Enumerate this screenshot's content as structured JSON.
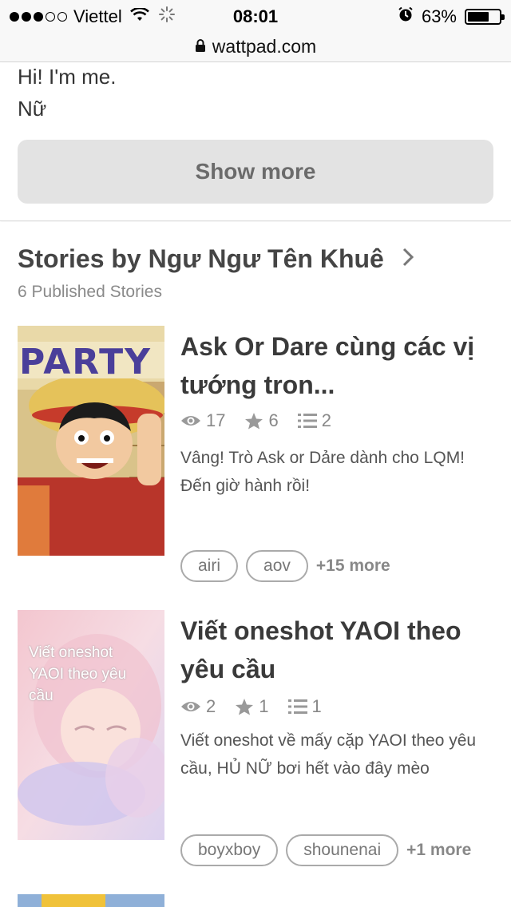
{
  "status": {
    "carrier": "Viettel",
    "time": "08:01",
    "battery": "63%",
    "battery_level": 0.63
  },
  "browser": {
    "url": "wattpad.com"
  },
  "about": {
    "lines": [
      "Hi! I'm me.",
      "Nữ"
    ],
    "show_more": "Show more"
  },
  "stories_section": {
    "title": "Stories by Ngư Ngư Tên Khuê",
    "subtitle": "6 Published Stories"
  },
  "stories": [
    {
      "title_lines": [
        "Ask Or Dare cùng các vị",
        "tướng tron..."
      ],
      "cover_text": "PARTY",
      "reads": "17",
      "votes": "6",
      "parts": "2",
      "desc_lines": [
        "Vâng! Trò Ask or Dảre dành cho LQM!",
        "Đến giờ hành rồi!"
      ],
      "tags": [
        "airi",
        "aov"
      ],
      "more": "+15 more"
    },
    {
      "title_lines": [
        "Viết oneshot YAOI theo",
        "yêu cầu"
      ],
      "cover_text_lines": [
        "Viết oneshot",
        "YAOI theo yêu",
        "cầu"
      ],
      "reads": "2",
      "votes": "1",
      "parts": "1",
      "desc_lines": [
        "Viết oneshot về mấy cặp YAOI theo yêu",
        "cầu, HỦ NỮ bơi hết vào đây mèo"
      ],
      "tags": [
        "boyxboy",
        "shounenai"
      ],
      "more": "+1 more"
    }
  ],
  "icons": {
    "reads": "eye-icon",
    "votes": "star-icon",
    "parts": "list-icon",
    "chevron": "chevron-right-icon",
    "lock": "lock-icon"
  },
  "colors": {
    "title": "#3a3a3a",
    "muted": "#888888",
    "button_bg": "#e3e3e3"
  }
}
